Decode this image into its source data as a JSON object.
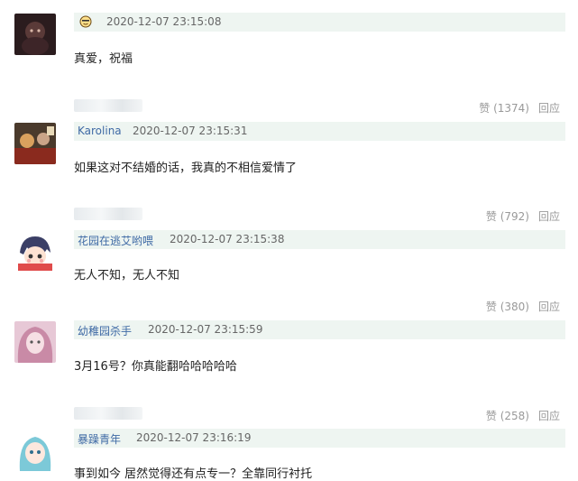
{
  "comments": [
    {
      "user": "",
      "time": "2020-12-07 23:15:08",
      "text": "真爱，祝福",
      "likes_label": "赞 (1374)",
      "reply_label": "回应"
    },
    {
      "user": "Karolina",
      "time": "2020-12-07 23:15:31",
      "text": "如果这对不结婚的话，我真的不相信爱情了",
      "likes_label": "赞 (792)",
      "reply_label": "回应"
    },
    {
      "user": "花园在逃艾哟喂",
      "time": "2020-12-07 23:15:38",
      "text": "无人不知，无人不知",
      "likes_label": "赞 (380)",
      "reply_label": "回应"
    },
    {
      "user": "幼稚园杀手",
      "time": "2020-12-07 23:15:59",
      "text": "3月16号？你真能翻哈哈哈哈哈",
      "likes_label": "赞 (258)",
      "reply_label": "回应"
    },
    {
      "user": "暴躁青年",
      "time": "2020-12-07 23:16:19",
      "text": "事到如今 居然觉得还有点专一？全靠同行衬托"
    }
  ],
  "icons": {
    "first_user": "smiley-emoji-icon"
  },
  "colors": {
    "meta_bg": "#eef5f1",
    "username": "#3f6aa5",
    "muted": "#999999"
  }
}
